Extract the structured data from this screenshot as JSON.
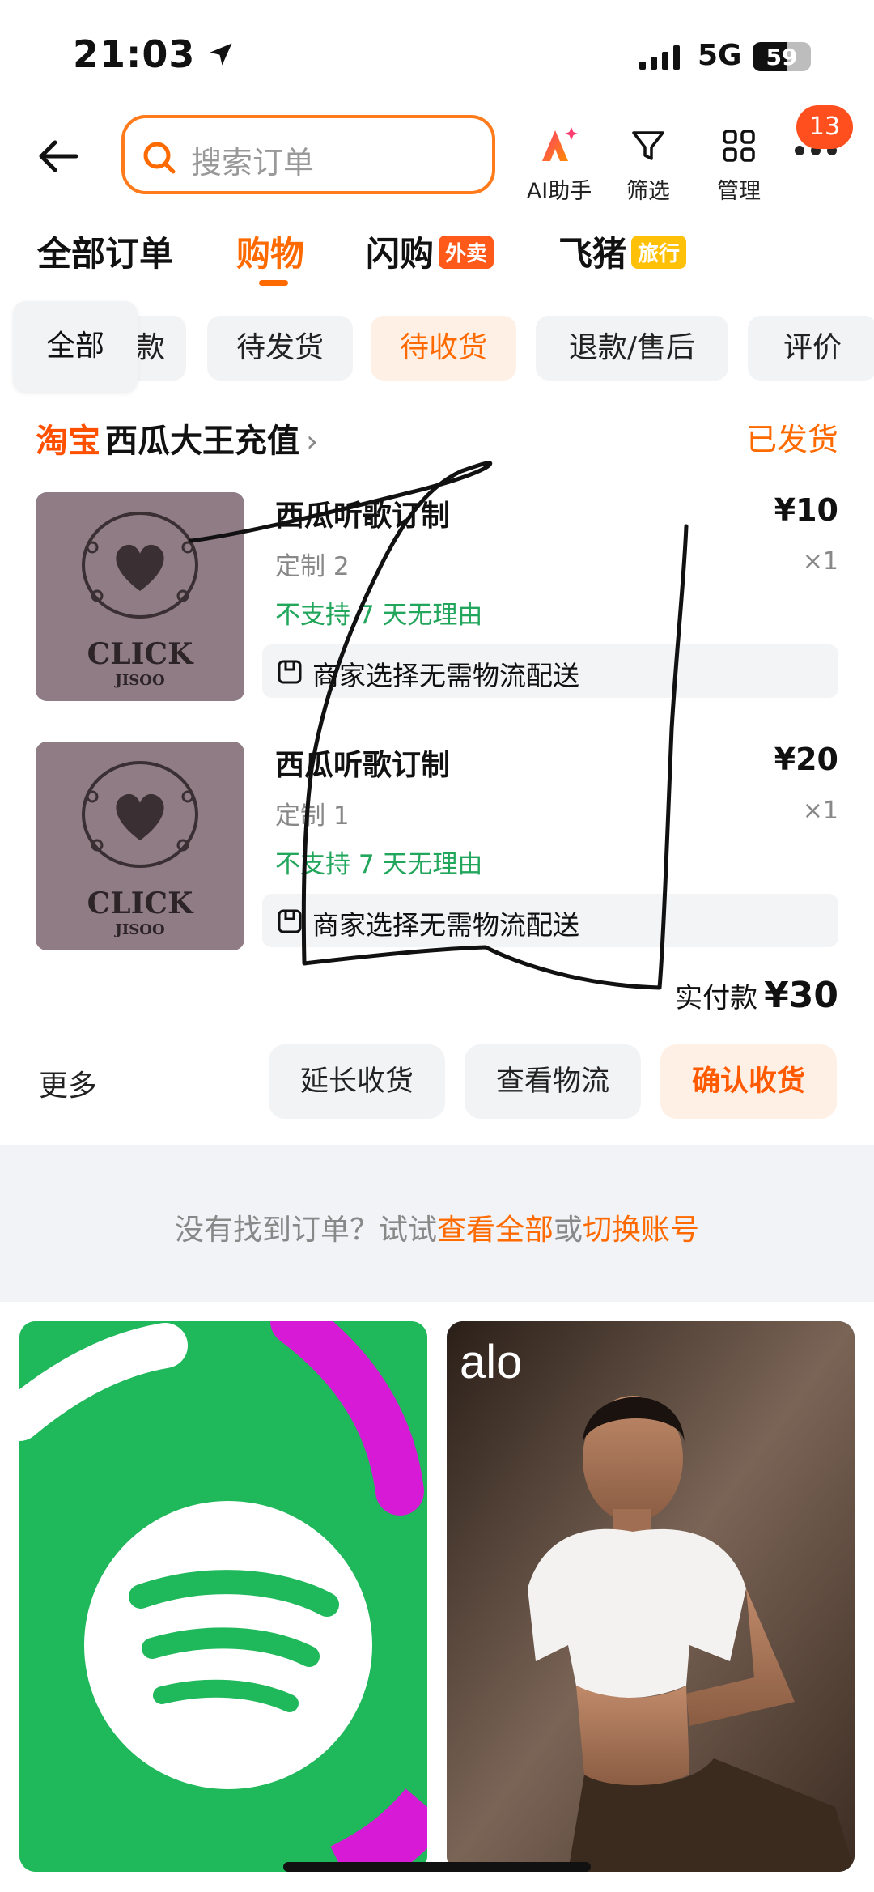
{
  "status_bar": {
    "time": "21:03",
    "network": "5G",
    "battery": "59",
    "battery_level": 0.59
  },
  "header": {
    "search_placeholder": "搜索订单",
    "tools": [
      {
        "label": "AI助手",
        "icon": "ai-assistant-icon"
      },
      {
        "label": "筛选",
        "icon": "filter-icon"
      },
      {
        "label": "管理",
        "icon": "grid-manage-icon"
      }
    ],
    "more_badge": "13"
  },
  "main_tabs": [
    {
      "label": "全部订单"
    },
    {
      "label": "购物",
      "active": true
    },
    {
      "label": "闪购",
      "tag": "外卖"
    },
    {
      "label": "飞猪",
      "tag": "旅行"
    }
  ],
  "filters": {
    "all": "全部",
    "partial": "款",
    "items": [
      "待发货",
      "待收货",
      "退款/售后",
      "评价"
    ],
    "active": "待收货"
  },
  "order": {
    "shop_logo": "淘宝",
    "shop_name": "西瓜大王充值",
    "status": "已发货",
    "items": [
      {
        "title": "西瓜听歌订制",
        "price": "¥10",
        "spec": "定制 2",
        "qty": "×1",
        "warning": "不支持 7 天无理由",
        "shipping": "商家选择无需物流配送",
        "cover_text": "CLICK",
        "cover_sub": "JISOO"
      },
      {
        "title": "西瓜听歌订制",
        "price": "¥20",
        "spec": "定制 1",
        "qty": "×1",
        "warning": "不支持 7 天无理由",
        "shipping": "商家选择无需物流配送",
        "cover_text": "CLICK",
        "cover_sub": "JISOO"
      }
    ],
    "total_label": "实付款",
    "total_value": "¥30",
    "more": "更多",
    "actions": [
      "延长收货",
      "查看物流",
      "确认收货"
    ]
  },
  "empty_hint": {
    "text": "没有找到订单？试试",
    "link1": "查看全部",
    "or": "或",
    "link2": "切换账号"
  },
  "feed": [
    {
      "brand": "spotify",
      "icon": "spotify-logo-icon"
    },
    {
      "brand": "alo",
      "icon": "alo-logo"
    }
  ],
  "colors": {
    "accent": "#ff6a00",
    "green": "#21a65b",
    "spotify_green": "#1fb85a"
  }
}
